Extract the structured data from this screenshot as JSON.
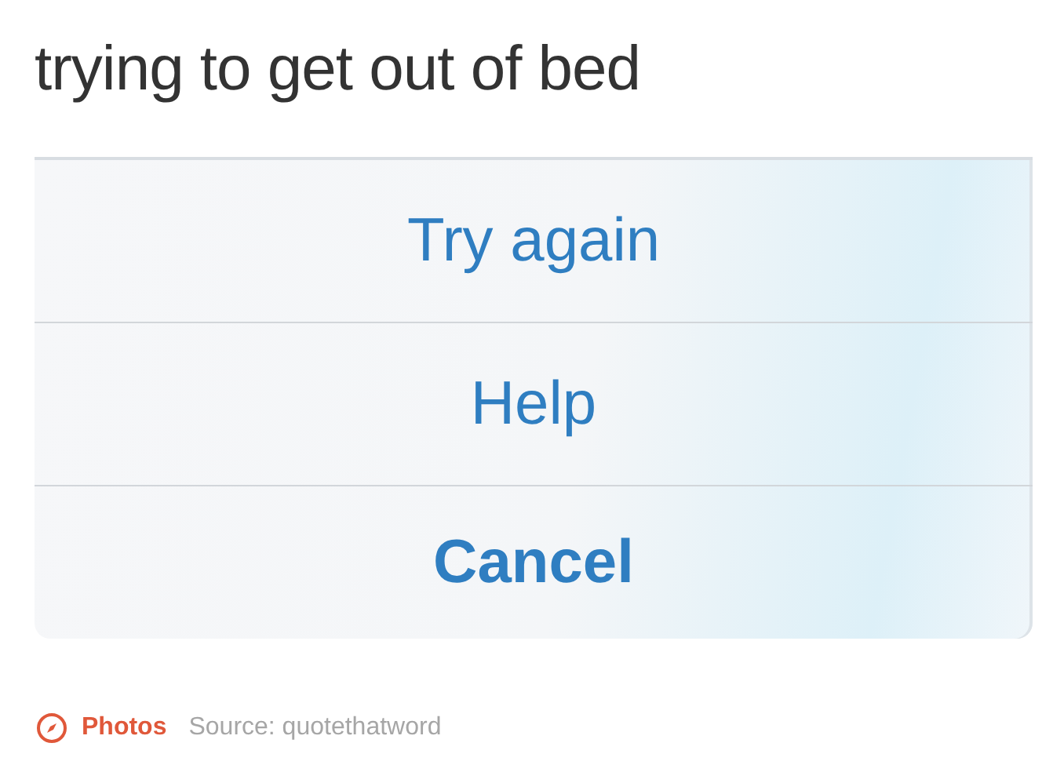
{
  "post": {
    "title": "trying to get out of bed"
  },
  "action_sheet": {
    "buttons": [
      {
        "label": "Try again",
        "kind": "default"
      },
      {
        "label": "Help",
        "kind": "default"
      },
      {
        "label": "Cancel",
        "kind": "cancel"
      }
    ]
  },
  "footer": {
    "tag": "Photos",
    "source": "Source: quotethatword"
  }
}
